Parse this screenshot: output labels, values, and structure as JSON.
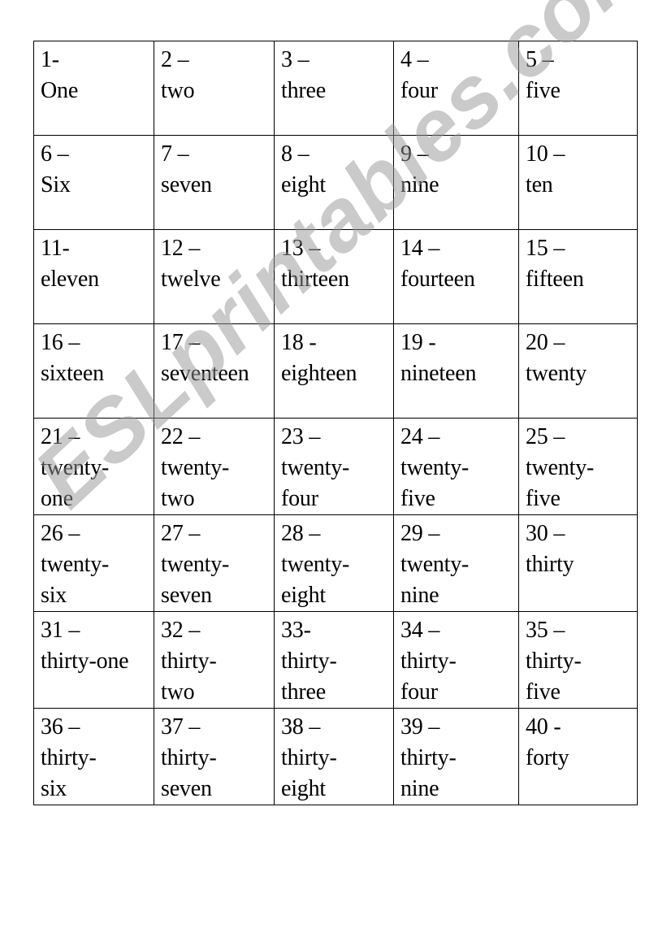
{
  "document": {
    "type": "number-words-worksheet",
    "watermark": "ESLprintables.com",
    "rows": [
      [
        {
          "num": "1-",
          "word": "One"
        },
        {
          "num": "2 –",
          "word": "two"
        },
        {
          "num": "3 –",
          "word": "three"
        },
        {
          "num": "4 –",
          "word": "four"
        },
        {
          "num": "5 –",
          "word": "five"
        }
      ],
      [
        {
          "num": "6 –",
          "word": "Six"
        },
        {
          "num": "7 –",
          "word": "seven"
        },
        {
          "num": "8 –",
          "word": "eight"
        },
        {
          "num": "9 –",
          "word": "nine"
        },
        {
          "num": "10 –",
          "word": "ten"
        }
      ],
      [
        {
          "num": "11-",
          "word": "eleven"
        },
        {
          "num": "12 –",
          "word": "twelve"
        },
        {
          "num": "13 –",
          "word": "thirteen"
        },
        {
          "num": "14 –",
          "word": "fourteen"
        },
        {
          "num": "15 –",
          "word": "fifteen"
        }
      ],
      [
        {
          "num": "16 –",
          "word": "sixteen"
        },
        {
          "num": "17 –",
          "word": "seventeen"
        },
        {
          "num": "18 -",
          "word": "eighteen"
        },
        {
          "num": "19 -",
          "word": "nineteen"
        },
        {
          "num": "20 –",
          "word": "twenty"
        }
      ],
      [
        {
          "num": "21 –",
          "word": "twenty-",
          "word2": "one"
        },
        {
          "num": "22 –",
          "word": "twenty-",
          "word2": "two"
        },
        {
          "num": "23 –",
          "word": "twenty-",
          "word2": "four"
        },
        {
          "num": "24 –",
          "word": "twenty-",
          "word2": "five"
        },
        {
          "num": "25 –",
          "word": "twenty-",
          "word2": "five"
        }
      ],
      [
        {
          "num": "26 –",
          "word": "twenty-",
          "word2": "six"
        },
        {
          "num": "27 –",
          "word": "twenty-",
          "word2": "seven"
        },
        {
          "num": "28 –",
          "word": "twenty-",
          "word2": "eight"
        },
        {
          "num": "29 –",
          "word": "twenty-",
          "word2": "nine"
        },
        {
          "num": "30 –",
          "word": "thirty"
        }
      ],
      [
        {
          "num": "31 –",
          "word": "thirty-one"
        },
        {
          "num": "32 –",
          "word": "thirty-",
          "word2": "two"
        },
        {
          "num": "33-",
          "word": "thirty-",
          "word2": "three"
        },
        {
          "num": "34 –",
          "word": "thirty-",
          "word2": "four"
        },
        {
          "num": "35 –",
          "word": "thirty-",
          "word2": "five"
        }
      ],
      [
        {
          "num": "36 –",
          "word": "thirty-",
          "word2": "six"
        },
        {
          "num": "37 –",
          "word": "thirty-",
          "word2": "seven"
        },
        {
          "num": "38 –",
          "word": "thirty-",
          "word2": "eight"
        },
        {
          "num": "39 –",
          "word": "thirty-",
          "word2": "nine"
        },
        {
          "num": "40  -",
          "word": "forty"
        }
      ]
    ]
  }
}
